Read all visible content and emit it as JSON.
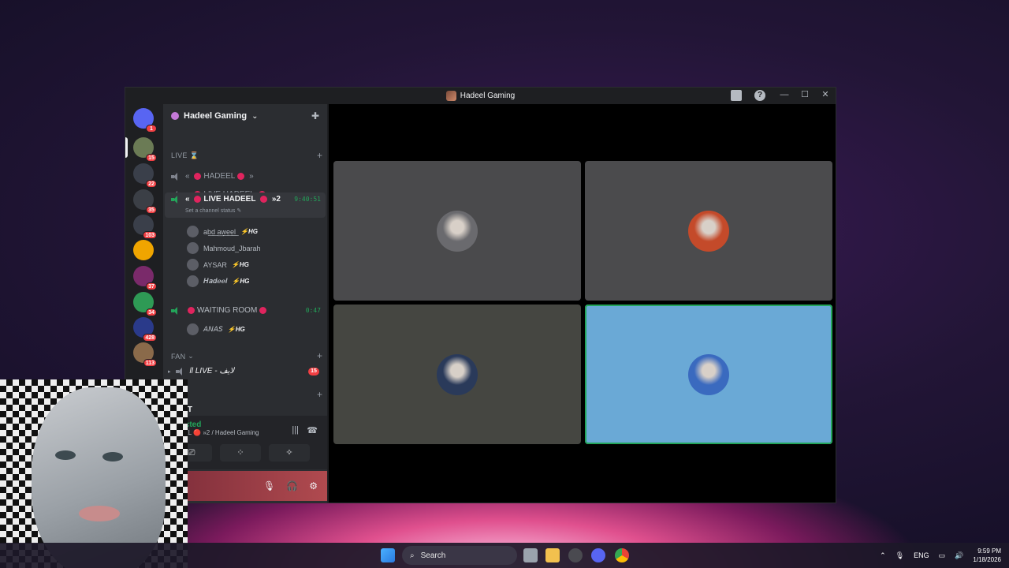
{
  "window": {
    "title": "Hadeel Gaming"
  },
  "titlebar": {
    "help_glyph": "?",
    "minimize": "—",
    "maximize": "☐",
    "close": "✕"
  },
  "guilds": [
    {
      "badge": "1",
      "color": "#5865f2"
    },
    {
      "badge": "15",
      "color": "#6b7b55"
    },
    {
      "badge": "22",
      "color": "#3a3f4a"
    },
    {
      "badge": "35",
      "color": "#3b3f46"
    },
    {
      "badge": "103",
      "color": "#3a3f4a"
    },
    {
      "badge": "",
      "color": "#f0a500"
    },
    {
      "badge": "37",
      "color": "#7a2a6a"
    },
    {
      "badge": "34",
      "color": "#2e9a55"
    },
    {
      "badge": "428",
      "color": "#2a3a8a"
    },
    {
      "badge": "113",
      "color": "#8a6a4a"
    }
  ],
  "sidebar": {
    "server_name": "Hadeel Gaming",
    "server_chevron": "⌄",
    "invite_icon": "person-add-icon",
    "categories": {
      "live": "LIVE ⌛",
      "fan": "FAN",
      "left_category": "ve",
      "left": "LEFT"
    },
    "channels": {
      "ch1": "HADEEL",
      "ch2": "LIVE HADEEL",
      "ch3": "LIVE HADEEL",
      "ch3_suffix": "»2",
      "ch3_status": "Set a channel status",
      "ch3_timer": "9:40:51",
      "waiting": "WAITING ROOM",
      "waiting_timer": "0:47",
      "fan_channel": "ll LIVE - لايف",
      "fan_badge": "15"
    },
    "users": [
      {
        "name": "ab͟d͟ a͟w͟e͟e͟l͟",
        "tag": "⚡HG"
      },
      {
        "name": "Mahmoud_Jbarah",
        "tag": ""
      },
      {
        "name": "AYSAR",
        "tag": "⚡HG"
      },
      {
        "name": "𝑯𝒂𝒅𝒆𝒆𝒍",
        "tag": "⚡HG"
      }
    ],
    "waiting_user": {
      "name": "𝘈𝘕𝘈𝘚",
      "tag": "⚡HG"
    }
  },
  "voice_panel": {
    "status": "nnected",
    "location": "ADEEL 🔴 »2 / Hadeel Gaming",
    "buttons": [
      "⎚",
      "⁘",
      "✧"
    ]
  },
  "user_panel": {
    "mic": "🎙",
    "headset": "🎧",
    "settings": "⚙"
  },
  "stage": {
    "tiles": [
      {
        "bg": "#4a4a4c",
        "avatar": "#6a6a6e",
        "speaking": false
      },
      {
        "bg": "#4b4b4d",
        "avatar": "#c44a2a",
        "speaking": false
      },
      {
        "bg": "#454641",
        "avatar": "#2a3a5a",
        "speaking": false
      },
      {
        "bg": "#6aa9d6",
        "avatar": "#3a6abf",
        "speaking": true
      }
    ]
  },
  "taskbar": {
    "search_placeholder": "Search",
    "tray_lang": "ENG",
    "time": "9:59 PM",
    "date": "1/18/2026"
  }
}
